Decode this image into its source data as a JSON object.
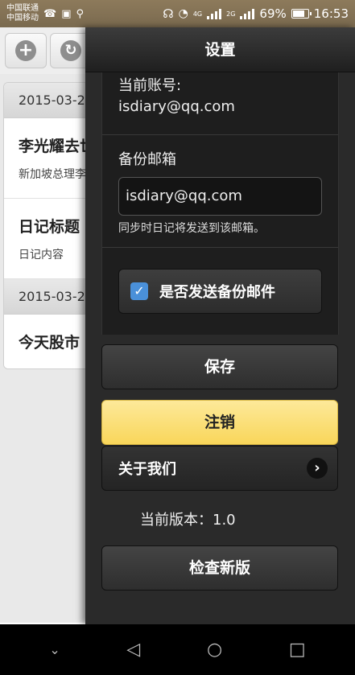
{
  "status_bar": {
    "carrier1": "中国联通",
    "carrier2": "中国移动",
    "net1": "4G",
    "net2": "2G",
    "battery": "69%",
    "time": "16:53"
  },
  "background_page": {
    "groups": [
      {
        "date": "2015-03-2",
        "items": [
          {
            "title": "李光耀去世",
            "subtitle": "新加坡总理李"
          },
          {
            "title": "日记标题",
            "subtitle": "日记内容"
          }
        ]
      },
      {
        "date": "2015-03-2",
        "items": [
          {
            "title": "今天股市",
            "subtitle": ""
          }
        ]
      }
    ]
  },
  "settings": {
    "title": "设置",
    "current_account_label": "当前账号:",
    "current_account_value": "isdiary@qq.com",
    "backup_email_label": "备份邮箱",
    "backup_email_value": "isdiary@qq.com",
    "backup_hint": "同步时日记将发送到该邮箱。",
    "send_backup_label": "是否发送备份邮件",
    "send_backup_checked": true,
    "save_label": "保存",
    "logout_label": "注销",
    "about_label": "关于我们",
    "version_text": "当前版本：1.0",
    "check_update_label": "检查新版",
    "accent_yellow": "#f9d65a",
    "accent_blue": "#4a90d9"
  }
}
